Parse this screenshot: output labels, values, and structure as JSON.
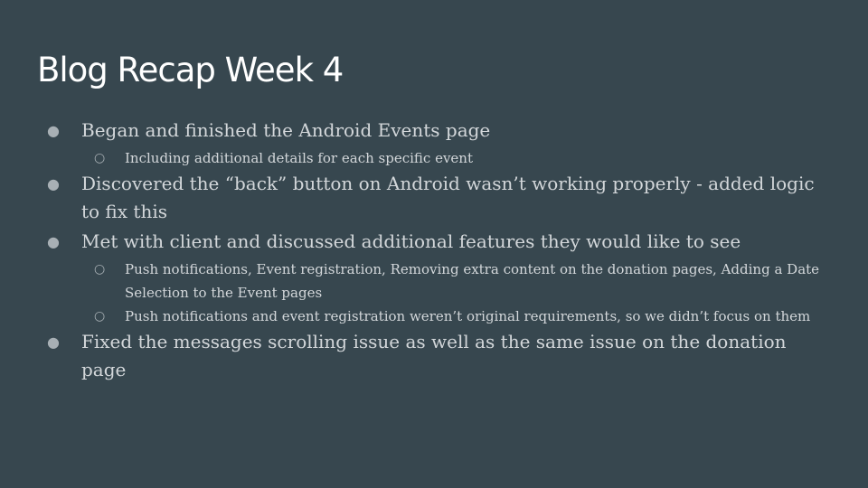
{
  "slide": {
    "title": "Blog Recap Week 4",
    "bullets": [
      {
        "text": "Began and finished the Android Events page",
        "sub": [
          "Including additional details for each specific event"
        ]
      },
      {
        "text": "Discovered the “back” button on Android wasn’t working properly - added logic to fix this",
        "sub": []
      },
      {
        "text": "Met with client and discussed additional features they would like to see",
        "sub": [
          "Push notifications, Event registration, Removing extra content on the donation pages, Adding a Date Selection to the Event pages",
          "Push notifications and event registration weren’t original requirements, so we didn’t focus on them"
        ]
      },
      {
        "text": "Fixed the messages scrolling issue as well as the same issue on the donation page",
        "sub": []
      }
    ],
    "bullet_glyph": "●",
    "sub_bullet_glyph": "○"
  },
  "colors": {
    "background": "#37474f",
    "title": "#ffffff",
    "body_text": "#d3d7da"
  }
}
